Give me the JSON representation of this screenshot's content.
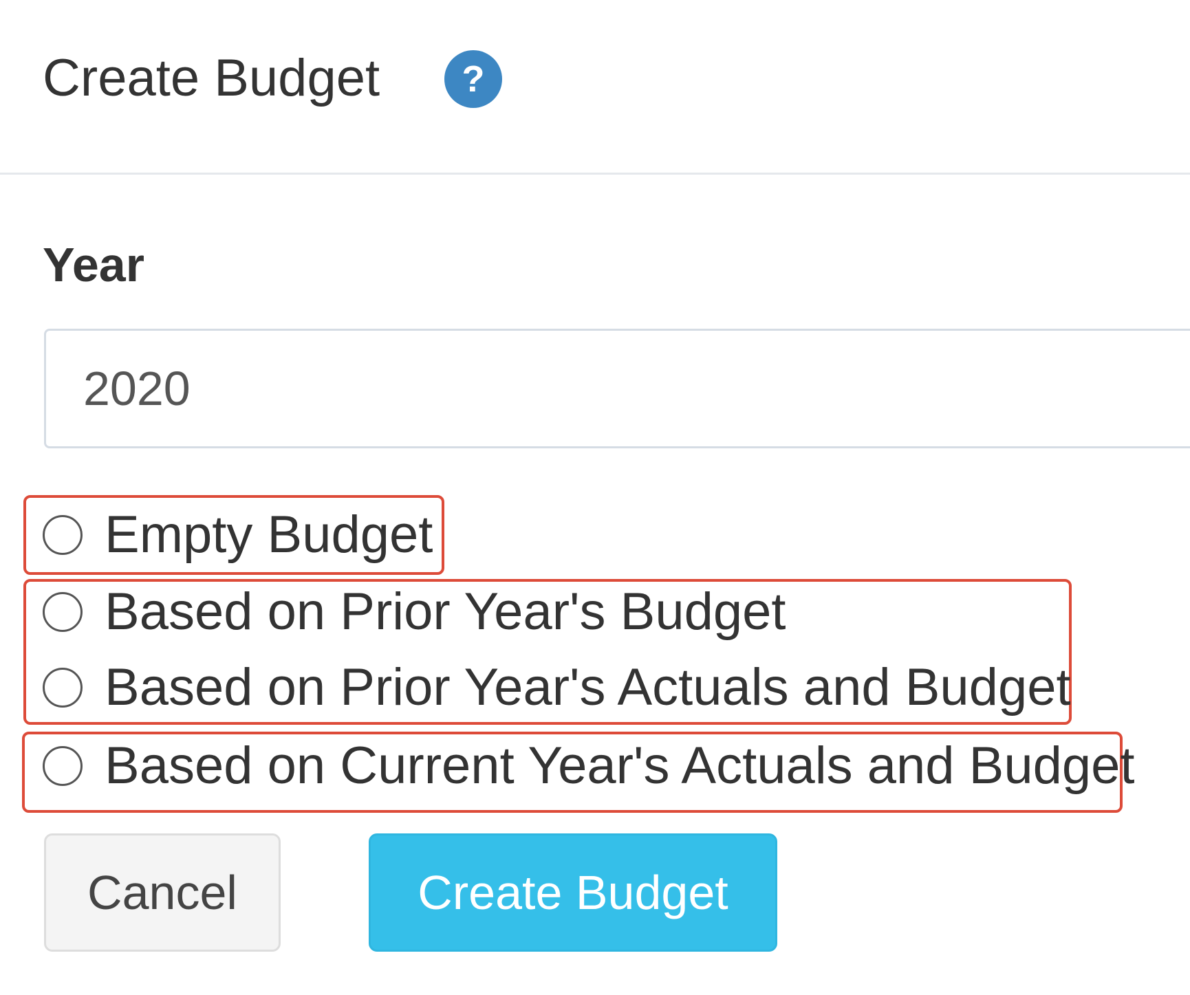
{
  "header": {
    "title": "Create Budget",
    "help_icon": "question-mark-circle-icon",
    "help_glyph": "?"
  },
  "form": {
    "year_label": "Year",
    "year_value": "2020",
    "options": [
      {
        "label": "Empty Budget",
        "selected": false
      },
      {
        "label": "Based on Prior Year's Budget",
        "selected": false
      },
      {
        "label": "Based on Prior Year's Actuals and Budget",
        "selected": false
      },
      {
        "label": "Based on Current Year's Actuals and Budget",
        "selected": false
      }
    ]
  },
  "actions": {
    "cancel_label": "Cancel",
    "create_label": "Create Budget"
  },
  "colors": {
    "accent": "#35bfe9",
    "help_icon": "#3d87c3",
    "highlight_box": "#dd4b39",
    "cancel_bg": "#f4f4f4"
  }
}
